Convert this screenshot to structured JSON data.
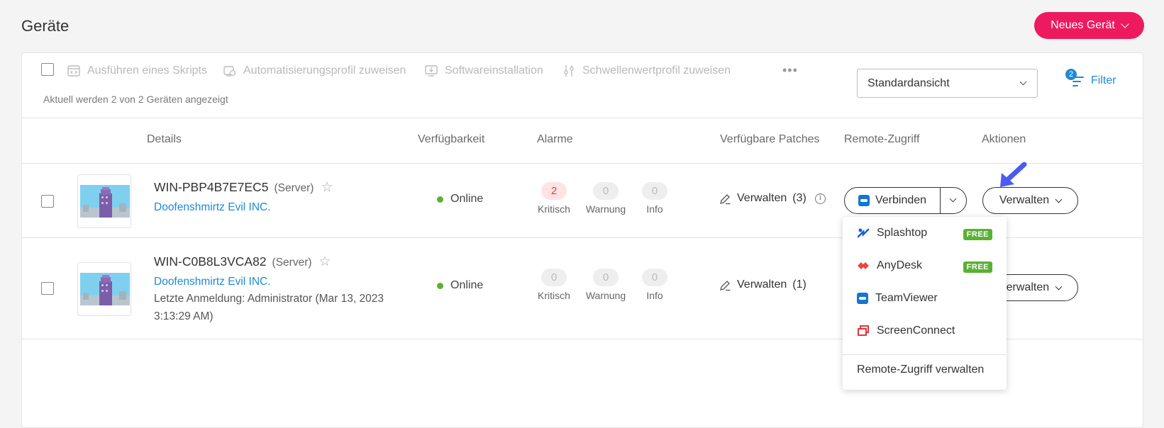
{
  "page": {
    "title": "Geräte",
    "new_device_label": "Neues Gerät"
  },
  "toolbar": {
    "actions": [
      {
        "label": "Ausführen eines Skripts",
        "icon": "script-icon"
      },
      {
        "label": "Automatisierungsprofil zuweisen",
        "icon": "automation-profile-icon"
      },
      {
        "label": "Softwareinstallation",
        "icon": "software-install-icon"
      },
      {
        "label": "Schwellenwertprofil zuweisen",
        "icon": "threshold-sliders-icon"
      }
    ],
    "more_label": "•••",
    "showing_text": "Aktuell werden 2 von 2 Geräten angezeigt",
    "view_select_value": "Standardansicht",
    "filter_label": "Filter",
    "filter_count": "2"
  },
  "columns": {
    "details": "Details",
    "availability": "Verfügbarkeit",
    "alarms": "Alarme",
    "patches": "Verfügbare Patches",
    "remote": "Remote-Zugriff",
    "actions": "Aktionen"
  },
  "devices": [
    {
      "name": "WIN-PBP4B7E7EC5",
      "type": "(Server)",
      "org": "Doofenshmirtz Evil INC.",
      "status": "Online",
      "alarms": {
        "critical": "2",
        "warning": "0",
        "info": "0"
      },
      "alarm_labels": {
        "critical": "Kritisch",
        "warning": "Warnung",
        "info": "Info"
      },
      "patches_label": "Verwalten",
      "patches_count": "(3)",
      "connect_label": "Verbinden",
      "manage_label": "Verwalten"
    },
    {
      "name": "WIN-C0B8L3VCA82",
      "type": "(Server)",
      "org": "Doofenshmirtz Evil INC.",
      "last_login_line1": "Letzte Anmeldung: Administrator (Mar 13, 2023",
      "last_login_line2": "3:13:29 AM)",
      "status": "Online",
      "alarms": {
        "critical": "0",
        "warning": "0",
        "info": "0"
      },
      "alarm_labels": {
        "critical": "Kritisch",
        "warning": "Warnung",
        "info": "Info"
      },
      "patches_label": "Verwalten",
      "patches_count": "(1)",
      "manage_label": "Verwalten"
    }
  ],
  "remote_dropdown": {
    "items": [
      {
        "label": "Splashtop",
        "badge": "FREE",
        "icon": "splashtop-icon"
      },
      {
        "label": "AnyDesk",
        "badge": "FREE",
        "icon": "anydesk-icon"
      },
      {
        "label": "TeamViewer",
        "icon": "teamviewer-icon"
      },
      {
        "label": "ScreenConnect",
        "icon": "screenconnect-icon"
      }
    ],
    "footer_label": "Remote-Zugriff verwalten"
  },
  "colors": {
    "brand": "#ee1a5f",
    "link": "#1f8ad6",
    "online": "#5cb130",
    "critical": "#e23b3b",
    "free_badge": "#5ab033",
    "pointer_arrow": "#4a5cf0"
  }
}
